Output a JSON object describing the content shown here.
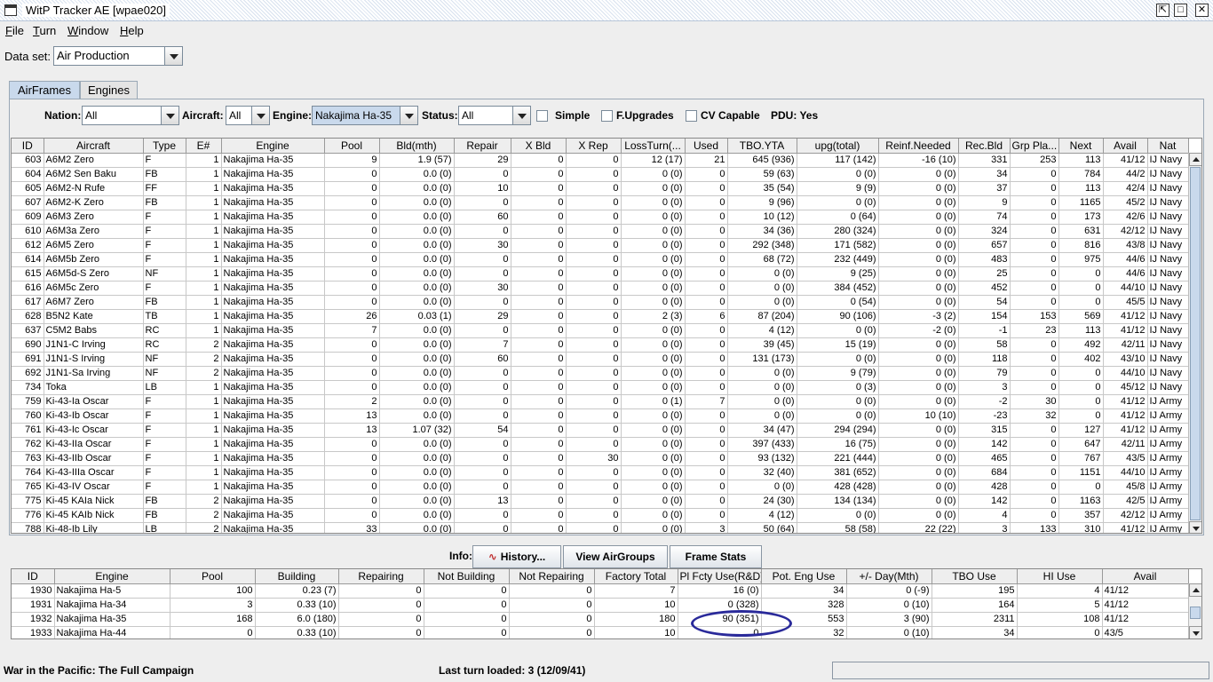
{
  "window": {
    "title": "WitP Tracker AE [wpae020]"
  },
  "menu": [
    "File",
    "Turn",
    "Window",
    "Help"
  ],
  "dataset": {
    "label": "Data set:",
    "value": "Air Production"
  },
  "tabs": [
    "AirFrames",
    "Engines"
  ],
  "filters": {
    "nation_label": "Nation:",
    "nation_value": "All",
    "aircraft_label": "Aircraft:",
    "aircraft_value": "All",
    "engine_label": "Engine:",
    "engine_value": "Nakajima Ha-35",
    "status_label": "Status:",
    "status_value": "All",
    "simple_label": "Simple",
    "fupgrades_label": "F.Upgrades",
    "cv_label": "CV Capable",
    "pdu_label": "PDU: Yes"
  },
  "airframes": {
    "columns": [
      "ID",
      "Aircraft",
      "Type",
      "E#",
      "Engine",
      "Pool",
      "Bld(mth)",
      "Repair",
      "X Bld",
      "X Rep",
      "LossTurn(...",
      "Used",
      "TBO.YTA",
      "upg(total)",
      "Reinf.Needed",
      "Rec.Bld",
      "Grp Pla...",
      "Next",
      "Avail",
      "Nat"
    ],
    "rows": [
      [
        "603",
        "A6M2 Zero",
        "F",
        "1",
        "Nakajima Ha-35",
        "9",
        "1.9 (57)",
        "29",
        "0",
        "0",
        "12 (17)",
        "21",
        "645 (936)",
        "117 (142)",
        "-16 (10)",
        "331",
        "253",
        "113",
        "41/12",
        "IJ Navy"
      ],
      [
        "604",
        "A6M2 Sen Baku",
        "FB",
        "1",
        "Nakajima Ha-35",
        "0",
        "0.0 (0)",
        "0",
        "0",
        "0",
        "0 (0)",
        "0",
        "59 (63)",
        "0 (0)",
        "0 (0)",
        "34",
        "0",
        "784",
        "44/2",
        "IJ Navy"
      ],
      [
        "605",
        "A6M2-N Rufe",
        "FF",
        "1",
        "Nakajima Ha-35",
        "0",
        "0.0 (0)",
        "10",
        "0",
        "0",
        "0 (0)",
        "0",
        "35 (54)",
        "9 (9)",
        "0 (0)",
        "37",
        "0",
        "113",
        "42/4",
        "IJ Navy"
      ],
      [
        "607",
        "A6M2-K Zero",
        "FB",
        "1",
        "Nakajima Ha-35",
        "0",
        "0.0 (0)",
        "0",
        "0",
        "0",
        "0 (0)",
        "0",
        "9 (96)",
        "0 (0)",
        "0 (0)",
        "9",
        "0",
        "1165",
        "45/2",
        "IJ Navy"
      ],
      [
        "609",
        "A6M3 Zero",
        "F",
        "1",
        "Nakajima Ha-35",
        "0",
        "0.0 (0)",
        "60",
        "0",
        "0",
        "0 (0)",
        "0",
        "10 (12)",
        "0 (64)",
        "0 (0)",
        "74",
        "0",
        "173",
        "42/6",
        "IJ Navy"
      ],
      [
        "610",
        "A6M3a Zero",
        "F",
        "1",
        "Nakajima Ha-35",
        "0",
        "0.0 (0)",
        "0",
        "0",
        "0",
        "0 (0)",
        "0",
        "34 (36)",
        "280 (324)",
        "0 (0)",
        "324",
        "0",
        "631",
        "42/12",
        "IJ Navy"
      ],
      [
        "612",
        "A6M5 Zero",
        "F",
        "1",
        "Nakajima Ha-35",
        "0",
        "0.0 (0)",
        "30",
        "0",
        "0",
        "0 (0)",
        "0",
        "292 (348)",
        "171 (582)",
        "0 (0)",
        "657",
        "0",
        "816",
        "43/8",
        "IJ Navy"
      ],
      [
        "614",
        "A6M5b Zero",
        "F",
        "1",
        "Nakajima Ha-35",
        "0",
        "0.0 (0)",
        "0",
        "0",
        "0",
        "0 (0)",
        "0",
        "68 (72)",
        "232 (449)",
        "0 (0)",
        "483",
        "0",
        "975",
        "44/6",
        "IJ Navy"
      ],
      [
        "615",
        "A6M5d-S Zero",
        "NF",
        "1",
        "Nakajima Ha-35",
        "0",
        "0.0 (0)",
        "0",
        "0",
        "0",
        "0 (0)",
        "0",
        "0 (0)",
        "9 (25)",
        "0 (0)",
        "25",
        "0",
        "0",
        "44/6",
        "IJ Navy"
      ],
      [
        "616",
        "A6M5c Zero",
        "F",
        "1",
        "Nakajima Ha-35",
        "0",
        "0.0 (0)",
        "30",
        "0",
        "0",
        "0 (0)",
        "0",
        "0 (0)",
        "384 (452)",
        "0 (0)",
        "452",
        "0",
        "0",
        "44/10",
        "IJ Navy"
      ],
      [
        "617",
        "A6M7 Zero",
        "FB",
        "1",
        "Nakajima Ha-35",
        "0",
        "0.0 (0)",
        "0",
        "0",
        "0",
        "0 (0)",
        "0",
        "0 (0)",
        "0 (54)",
        "0 (0)",
        "54",
        "0",
        "0",
        "45/5",
        "IJ Navy"
      ],
      [
        "628",
        "B5N2 Kate",
        "TB",
        "1",
        "Nakajima Ha-35",
        "26",
        "0.03 (1)",
        "29",
        "0",
        "0",
        "2 (3)",
        "6",
        "87 (204)",
        "90 (106)",
        "-3 (2)",
        "154",
        "153",
        "569",
        "41/12",
        "IJ Navy"
      ],
      [
        "637",
        "C5M2 Babs",
        "RC",
        "1",
        "Nakajima Ha-35",
        "7",
        "0.0 (0)",
        "0",
        "0",
        "0",
        "0 (0)",
        "0",
        "4 (12)",
        "0 (0)",
        "-2 (0)",
        "-1",
        "23",
        "113",
        "41/12",
        "IJ Navy"
      ],
      [
        "690",
        "J1N1-C Irving",
        "RC",
        "2",
        "Nakajima Ha-35",
        "0",
        "0.0 (0)",
        "7",
        "0",
        "0",
        "0 (0)",
        "0",
        "39 (45)",
        "15 (19)",
        "0 (0)",
        "58",
        "0",
        "492",
        "42/11",
        "IJ Navy"
      ],
      [
        "691",
        "J1N1-S Irving",
        "NF",
        "2",
        "Nakajima Ha-35",
        "0",
        "0.0 (0)",
        "60",
        "0",
        "0",
        "0 (0)",
        "0",
        "131 (173)",
        "0 (0)",
        "0 (0)",
        "118",
        "0",
        "402",
        "43/10",
        "IJ Navy"
      ],
      [
        "692",
        "J1N1-Sa Irving",
        "NF",
        "2",
        "Nakajima Ha-35",
        "0",
        "0.0 (0)",
        "0",
        "0",
        "0",
        "0 (0)",
        "0",
        "0 (0)",
        "9 (79)",
        "0 (0)",
        "79",
        "0",
        "0",
        "44/10",
        "IJ Navy"
      ],
      [
        "734",
        "Toka",
        "LB",
        "1",
        "Nakajima Ha-35",
        "0",
        "0.0 (0)",
        "0",
        "0",
        "0",
        "0 (0)",
        "0",
        "0 (0)",
        "0 (3)",
        "0 (0)",
        "3",
        "0",
        "0",
        "45/12",
        "IJ Navy"
      ],
      [
        "759",
        "Ki-43-Ia Oscar",
        "F",
        "1",
        "Nakajima Ha-35",
        "2",
        "0.0 (0)",
        "0",
        "0",
        "0",
        "0 (1)",
        "7",
        "0 (0)",
        "0 (0)",
        "0 (0)",
        "-2",
        "30",
        "0",
        "41/12",
        "IJ Army"
      ],
      [
        "760",
        "Ki-43-Ib Oscar",
        "F",
        "1",
        "Nakajima Ha-35",
        "13",
        "0.0 (0)",
        "0",
        "0",
        "0",
        "0 (0)",
        "0",
        "0 (0)",
        "0 (0)",
        "10 (10)",
        "-23",
        "32",
        "0",
        "41/12",
        "IJ Army"
      ],
      [
        "761",
        "Ki-43-Ic Oscar",
        "F",
        "1",
        "Nakajima Ha-35",
        "13",
        "1.07 (32)",
        "54",
        "0",
        "0",
        "0 (0)",
        "0",
        "34 (47)",
        "294 (294)",
        "0 (0)",
        "315",
        "0",
        "127",
        "41/12",
        "IJ Army"
      ],
      [
        "762",
        "Ki-43-IIa Oscar",
        "F",
        "1",
        "Nakajima Ha-35",
        "0",
        "0.0 (0)",
        "0",
        "0",
        "0",
        "0 (0)",
        "0",
        "397 (433)",
        "16 (75)",
        "0 (0)",
        "142",
        "0",
        "647",
        "42/11",
        "IJ Army"
      ],
      [
        "763",
        "Ki-43-IIb Oscar",
        "F",
        "1",
        "Nakajima Ha-35",
        "0",
        "0.0 (0)",
        "0",
        "0",
        "30",
        "0 (0)",
        "0",
        "93 (132)",
        "221 (444)",
        "0 (0)",
        "465",
        "0",
        "767",
        "43/5",
        "IJ Army"
      ],
      [
        "764",
        "Ki-43-IIIa Oscar",
        "F",
        "1",
        "Nakajima Ha-35",
        "0",
        "0.0 (0)",
        "0",
        "0",
        "0",
        "0 (0)",
        "0",
        "32 (40)",
        "381 (652)",
        "0 (0)",
        "684",
        "0",
        "1151",
        "44/10",
        "IJ Army"
      ],
      [
        "765",
        "Ki-43-IV Oscar",
        "F",
        "1",
        "Nakajima Ha-35",
        "0",
        "0.0 (0)",
        "0",
        "0",
        "0",
        "0 (0)",
        "0",
        "0 (0)",
        "428 (428)",
        "0 (0)",
        "428",
        "0",
        "0",
        "45/8",
        "IJ Army"
      ],
      [
        "775",
        "Ki-45 KAIa Nick",
        "FB",
        "2",
        "Nakajima Ha-35",
        "0",
        "0.0 (0)",
        "13",
        "0",
        "0",
        "0 (0)",
        "0",
        "24 (30)",
        "134 (134)",
        "0 (0)",
        "142",
        "0",
        "1163",
        "42/5",
        "IJ Army"
      ],
      [
        "776",
        "Ki-45 KAIb Nick",
        "FB",
        "2",
        "Nakajima Ha-35",
        "0",
        "0.0 (0)",
        "0",
        "0",
        "0",
        "0 (0)",
        "0",
        "4 (12)",
        "0 (0)",
        "0 (0)",
        "4",
        "0",
        "357",
        "42/12",
        "IJ Army"
      ],
      [
        "788",
        "Ki-48-Ib Lily",
        "LB",
        "2",
        "Nakajima Ha-35",
        "33",
        "0.0 (0)",
        "0",
        "0",
        "0",
        "0 (0)",
        "3",
        "50 (64)",
        "58 (58)",
        "22 (22)",
        "3",
        "133",
        "310",
        "41/12",
        "IJ Army"
      ]
    ]
  },
  "info": {
    "label": "Info:",
    "history_button": "History...",
    "view_airgroups_button": "View AirGroups",
    "frame_stats_button": "Frame Stats"
  },
  "engines": {
    "columns": [
      "ID",
      "Engine",
      "Pool",
      "Building",
      "Repairing",
      "Not Building",
      "Not Repairing",
      "Factory Total",
      "Pl Fcty Use(R&D)",
      "Pot. Eng Use",
      "+/- Day(Mth)",
      "TBO Use",
      "HI Use",
      "Avail"
    ],
    "rows": [
      [
        "1930",
        "Nakajima Ha-5",
        "100",
        "0.23 (7)",
        "0",
        "0",
        "0",
        "7",
        "16 (0)",
        "34",
        "0 (-9)",
        "195",
        "4",
        "41/12"
      ],
      [
        "1931",
        "Nakajima Ha-34",
        "3",
        "0.33 (10)",
        "0",
        "0",
        "0",
        "10",
        "0 (328)",
        "328",
        "0 (10)",
        "164",
        "5",
        "41/12"
      ],
      [
        "1932",
        "Nakajima Ha-35",
        "168",
        "6.0 (180)",
        "0",
        "0",
        "0",
        "180",
        "90 (351)",
        "553",
        "3 (90)",
        "2311",
        "108",
        "41/12"
      ],
      [
        "1933",
        "Nakajima Ha-44",
        "0",
        "0.33 (10)",
        "0",
        "0",
        "0",
        "10",
        "0",
        "32",
        "0 (10)",
        "34",
        "0",
        "43/5"
      ]
    ]
  },
  "status": {
    "left": "War in the Pacific: The Full Campaign",
    "middle": "Last turn loaded: 3 (12/09/41)"
  }
}
